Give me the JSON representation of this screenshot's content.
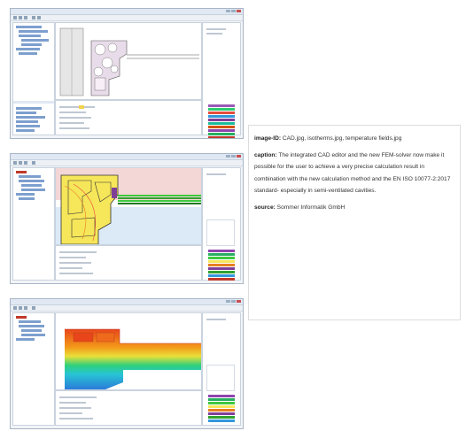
{
  "caption": {
    "image_id_label": "image-ID:",
    "image_id_value": "CAD.jpg, isotherms.jpg, temperature fields.jpg",
    "caption_label": "caption:",
    "caption_value": "The integrated CAD editor and the new FEM-solver now make it possible for the user to achieve a very precise calculation result in combination with the new calculation method and the EN ISO 10077-2:2017 standard- especially in semi-ventilated cavities.",
    "source_label": "source:",
    "source_value": "Sommer Informatik GmbH"
  },
  "screenshots": [
    {
      "name": "CAD editor"
    },
    {
      "name": "isotherms"
    },
    {
      "name": "temperature fields"
    }
  ],
  "colors": {
    "window_border": "#a9b6c5",
    "iso_yellow": "#f6e65a",
    "iso_pink": "#f3d6d6",
    "iso_blue": "#dce9f7",
    "iso_green": "#3ec93e",
    "temp_red": "#e8461a",
    "temp_orange": "#f39a1a",
    "temp_green": "#2fd17a",
    "temp_blue": "#2b7bd8"
  }
}
